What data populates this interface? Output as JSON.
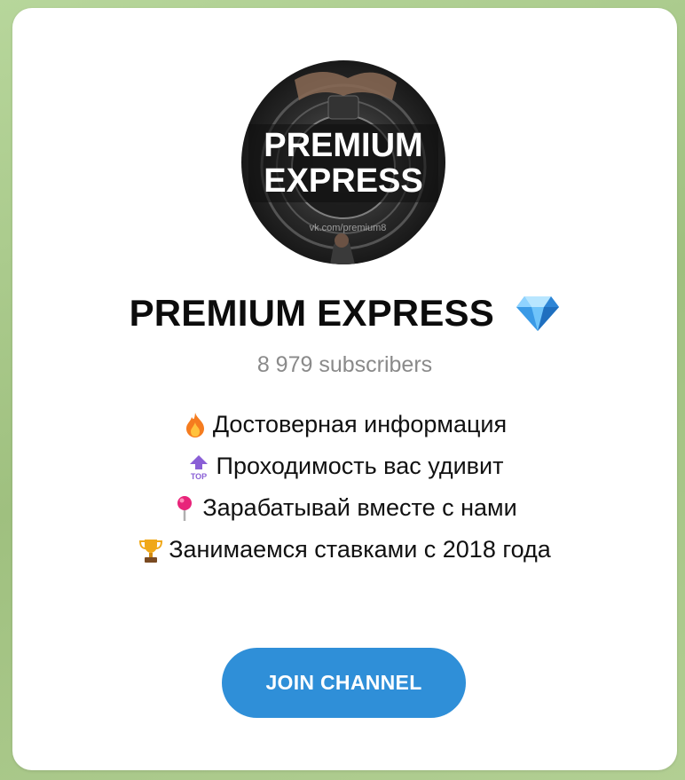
{
  "channel": {
    "name": "PREMIUM EXPRESS",
    "verified_icon": "gem-icon",
    "subscribers": "8 979 subscribers",
    "avatar_text_line1": "PREMIUM",
    "avatar_text_line2": "EXPRESS",
    "avatar_watermark": "vk.com/premium8"
  },
  "description": [
    {
      "icon": "fire-icon",
      "text": "Достоверная информация"
    },
    {
      "icon": "top-arrow-icon",
      "text": "Проходимость вас удивит"
    },
    {
      "icon": "pushpin-icon",
      "text": "Зарабатывай вместе с нами"
    },
    {
      "icon": "trophy-icon",
      "text": "Занимаемся ставками с 2018 года"
    }
  ],
  "actions": {
    "join_label": "JOIN CHANNEL"
  },
  "colors": {
    "accent": "#2f8fd8",
    "background": "#a9c98a",
    "card": "#ffffff",
    "muted_text": "#8a8a8a"
  }
}
